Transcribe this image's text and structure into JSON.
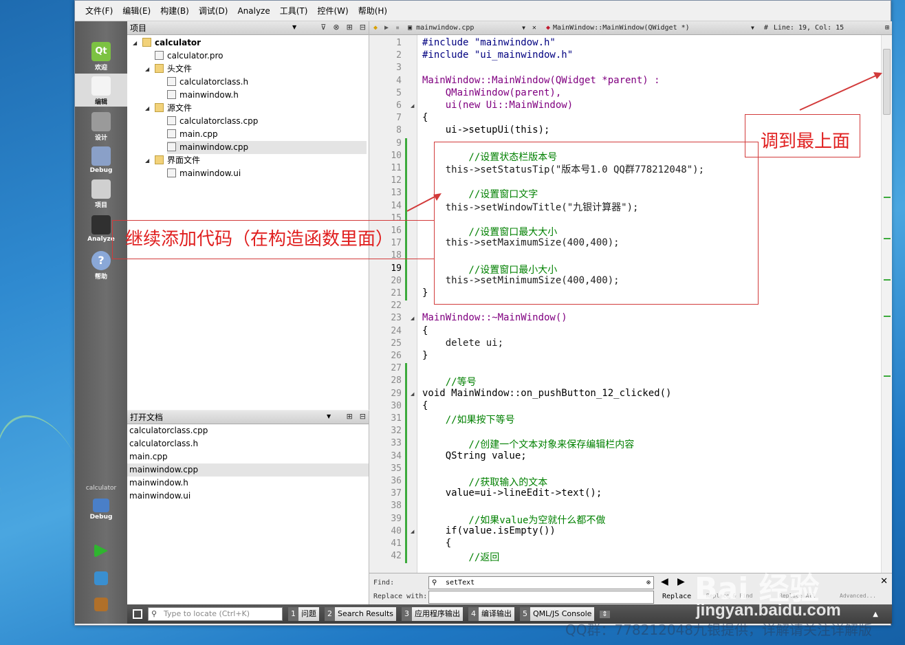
{
  "menubar": [
    "文件(F)",
    "编辑(E)",
    "构建(B)",
    "调试(D)",
    "Analyze",
    "工具(T)",
    "控件(W)",
    "帮助(H)"
  ],
  "modes": [
    {
      "label": "欢迎",
      "icon": "qt-logo-icon"
    },
    {
      "label": "编辑",
      "icon": "edit-document-icon"
    },
    {
      "label": "设计",
      "icon": "design-pen-icon"
    },
    {
      "label": "Debug",
      "icon": "debug-bug-icon"
    },
    {
      "label": "项目",
      "icon": "project-wrench-icon"
    },
    {
      "label": "Analyze",
      "icon": "analyze-chart-icon"
    },
    {
      "label": "帮助",
      "icon": "help-icon"
    }
  ],
  "kit": {
    "project": "calculator",
    "config": "Debug"
  },
  "project_panel": {
    "title": "项目",
    "tree": [
      {
        "label": "calculator",
        "bold": true
      },
      {
        "label": "calculator.pro"
      },
      {
        "label": "头文件"
      },
      {
        "label": "calculatorclass.h"
      },
      {
        "label": "mainwindow.h"
      },
      {
        "label": "源文件"
      },
      {
        "label": "calculatorclass.cpp"
      },
      {
        "label": "main.cpp"
      },
      {
        "label": "mainwindow.cpp",
        "selected": true
      },
      {
        "label": "界面文件"
      },
      {
        "label": "mainwindow.ui"
      }
    ]
  },
  "open_docs": {
    "title": "打开文档",
    "items": [
      "calculatorclass.cpp",
      "calculatorclass.h",
      "main.cpp",
      "mainwindow.cpp",
      "mainwindow.h",
      "mainwindow.ui"
    ],
    "selected_index": 3
  },
  "editor": {
    "file": "mainwindow.cpp",
    "symbol": "MainWindow::MainWindow(QWidget *)",
    "position": "Line: 19, Col: 15",
    "line_numbers": [
      "1",
      "2",
      "3",
      "4",
      "5",
      "6",
      "7",
      "8",
      "9",
      "10",
      "11",
      "12",
      "13",
      "14",
      "15",
      "16",
      "17",
      "18",
      "19",
      "20",
      "21",
      "22",
      "23",
      "24",
      "25",
      "26",
      "27",
      "28",
      "29",
      "30",
      "31",
      "32",
      "33",
      "34",
      "35",
      "36",
      "37",
      "38",
      "39",
      "40",
      "41",
      "42"
    ],
    "code": [
      "#include \"mainwindow.h\"",
      "#include \"ui_mainwindow.h\"",
      "",
      "MainWindow::MainWindow(QWidget *parent) :",
      "    QMainWindow(parent),",
      "    ui(new Ui::MainWindow)",
      "{",
      "    ui->setupUi(this);",
      "",
      "        //设置状态栏版本号",
      "    this->setStatusTip(\"版本号1.0 QQ群778212048\");",
      "",
      "        //设置窗口文字",
      "    this->setWindowTitle(\"九银计算器\");",
      "",
      "        //设置窗口最大大小",
      "    this->setMaximumSize(400,400);",
      "",
      "        //设置窗口最小大小",
      "    this->setMinimumSize(400,400);",
      "}",
      "",
      "MainWindow::~MainWindow()",
      "{",
      "    delete ui;",
      "}",
      "",
      "    //等号",
      "void MainWindow::on_pushButton_12_clicked()",
      "{",
      "    //如果按下等号",
      "",
      "        //创建一个文本对象来保存编辑栏内容",
      "    QString value;",
      "",
      "        //获取输入的文本",
      "    value=ui->lineEdit->text();",
      "",
      "        //如果value为空就什么都不做",
      "    if(value.isEmpty())",
      "    {",
      "        //返回"
    ]
  },
  "find": {
    "find_label": "Find:",
    "find_value": "setText",
    "replace_label": "Replace with:",
    "replace_value": "",
    "replace_btn": "Replace",
    "replace_find_btn": "Replace & Find",
    "replace_all_btn": "Replace All",
    "advanced_btn": "Advanced..."
  },
  "statusbar": {
    "locate_placeholder": "Type to locate (Ctrl+K)",
    "tabs": [
      {
        "n": "1",
        "t": "问题"
      },
      {
        "n": "2",
        "t": "Search Results"
      },
      {
        "n": "3",
        "t": "应用程序输出"
      },
      {
        "n": "4",
        "t": "编译输出"
      },
      {
        "n": "5",
        "t": "QML/JS Console"
      }
    ]
  },
  "annotations": {
    "top_note": "调到最上面",
    "left_note": "继续添加代码（在构造函数里面）"
  },
  "watermark": {
    "brand": "Bai  经验",
    "url": "jingyan.baidu.com",
    "footer": "QQ群：778212048九银提供，详解请关注详解版"
  }
}
